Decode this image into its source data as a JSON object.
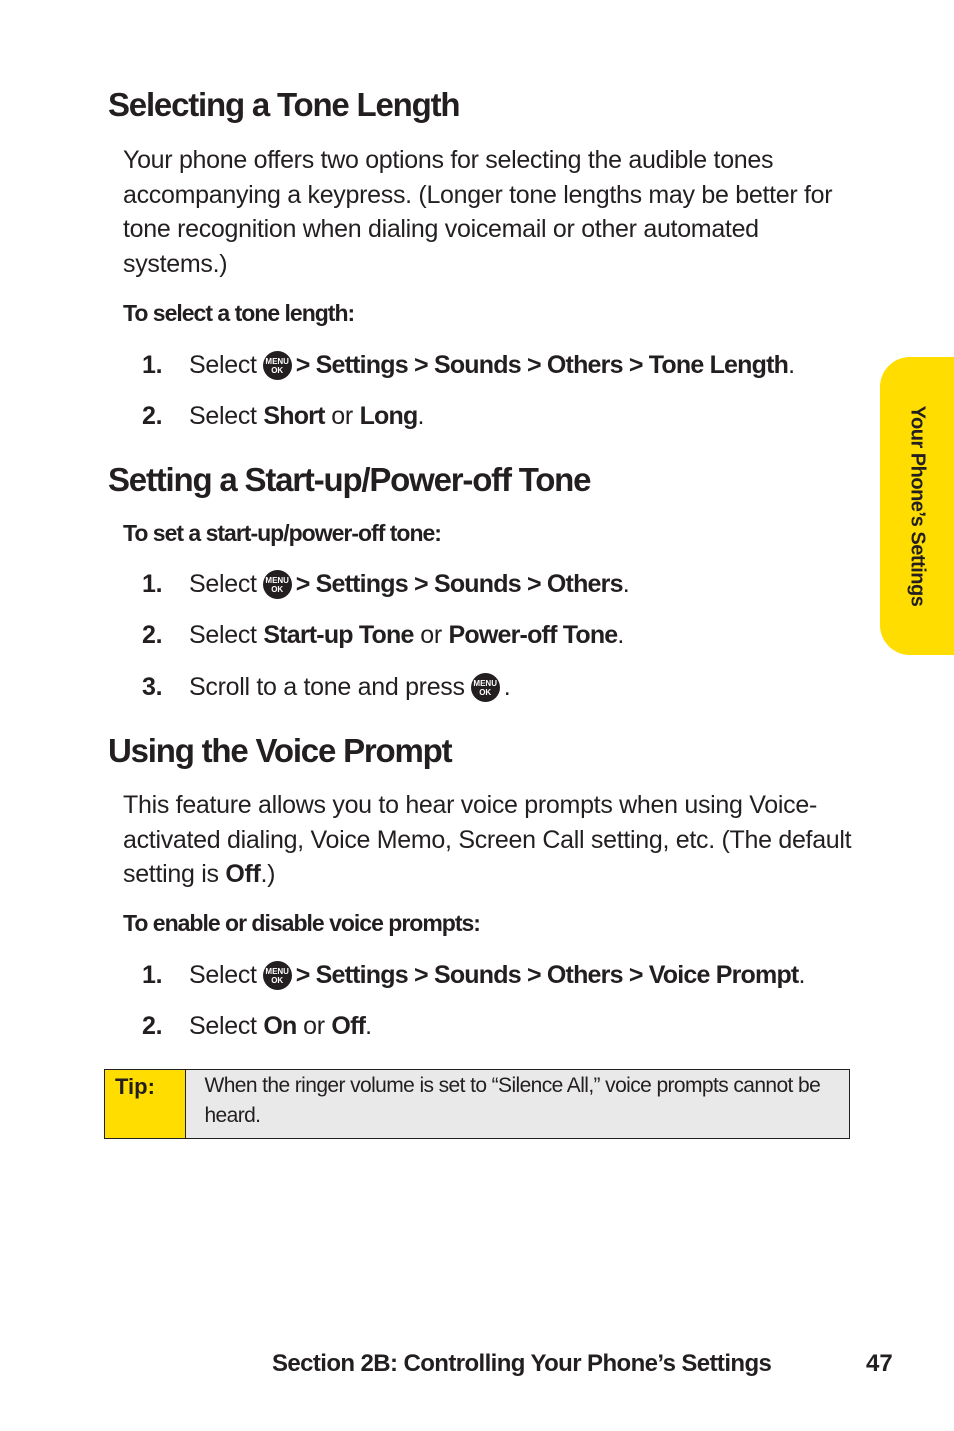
{
  "sections": [
    {
      "title": "Selecting a Tone Length",
      "body": "Your phone offers two options for selecting the audible tones accompanying a keypress. (Longer tone lengths may be better for tone recognition when dialing voicemail or other automated systems.)",
      "subheading": "To select a tone length:",
      "steps": [
        {
          "num": "1.",
          "pre": "Select",
          "icon": "menu-ok-icon",
          "path": "> Settings > Sounds > Others > Tone Length",
          "post": "."
        },
        {
          "num": "2.",
          "pre": "Select",
          "a": "Short",
          "mid": "or",
          "b": "Long",
          "post": "."
        }
      ]
    },
    {
      "title": "Setting a Start-up/Power-off Tone",
      "subheading": "To set a start-up/power-off tone:",
      "steps": [
        {
          "num": "1.",
          "pre": "Select",
          "icon": "menu-ok-icon",
          "path": "> Settings > Sounds > Others",
          "post": "."
        },
        {
          "num": "2.",
          "pre": "Select",
          "a": "Start-up Tone",
          "mid": "or",
          "b": "Power-off Tone",
          "post": "."
        },
        {
          "num": "3.",
          "pre": "Scroll to a tone and press",
          "icon": "menu-ok-icon",
          "post": "."
        }
      ]
    },
    {
      "title": "Using the Voice Prompt",
      "body_pre": "This feature allows you to hear voice prompts when using Voice-activated dialing, Voice Memo, Screen Call setting, etc. (The default setting is",
      "body_bold": "Off",
      "body_post": ".)",
      "subheading": "To enable or disable voice prompts:",
      "steps": [
        {
          "num": "1.",
          "pre": "Select",
          "icon": "menu-ok-icon",
          "path": "> Settings > Sounds > Others > Voice Prompt",
          "post": "."
        },
        {
          "num": "2.",
          "pre": "Select",
          "a": "On",
          "mid": "or",
          "b": "Off",
          "post": "."
        }
      ]
    }
  ],
  "menu_icon": {
    "line1": "MENU",
    "line2": "OK"
  },
  "tip": {
    "label": "Tip:",
    "text": "When the ringer volume is set to “Silence All,” voice prompts cannot be heard."
  },
  "side_tab": {
    "label": "Your Phone’s Settings",
    "color": "#ffdd00"
  },
  "footer": {
    "section": "Section 2B: Controlling Your Phone’s Settings",
    "page": "47"
  }
}
